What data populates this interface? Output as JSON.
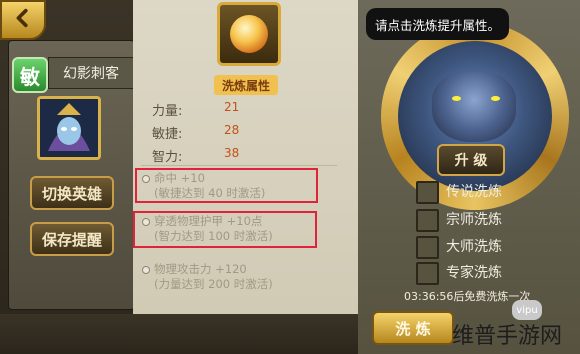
{
  "hero": {
    "attribute_badge": "敏",
    "name": "幻影刺客"
  },
  "buttons": {
    "switch_hero": "切换英雄",
    "save_reminder": "保存提醒",
    "upgrade": "升 级",
    "refine": "洗 炼"
  },
  "refine_panel": {
    "title": "洗炼属性",
    "stats": [
      {
        "label": "力量:",
        "value": "21"
      },
      {
        "label": "敏捷:",
        "value": "28"
      },
      {
        "label": "智力:",
        "value": "38"
      }
    ],
    "bonuses": [
      {
        "name": "命中 +10",
        "requirement": "(敏捷达到 40 时激活)"
      },
      {
        "name": "穿透物理护甲 +10点",
        "requirement": "(智力达到 100 时激活)"
      },
      {
        "name": "物理攻击力 +120",
        "requirement": "(力量达到 200 时激活)"
      }
    ],
    "highlight_color": "#e0233a"
  },
  "tooltip": "请点击洗炼提升属性。",
  "refine_options": [
    {
      "label": "传说洗炼",
      "checked": false
    },
    {
      "label": "宗师洗炼",
      "checked": false
    },
    {
      "label": "大师洗炼",
      "checked": false
    },
    {
      "label": "专家洗炼",
      "checked": false
    }
  ],
  "free_refine_timer": "03:36:56后免费洗炼一次",
  "watermark": {
    "text": "维普手游网",
    "logo": "vipu"
  },
  "icons": {
    "back": "back-arrow-icon",
    "item": "gem-icon"
  },
  "colors": {
    "gold": "#d9a93a",
    "stat_value": "#c2511d",
    "parchment": "#ddd8c6"
  }
}
